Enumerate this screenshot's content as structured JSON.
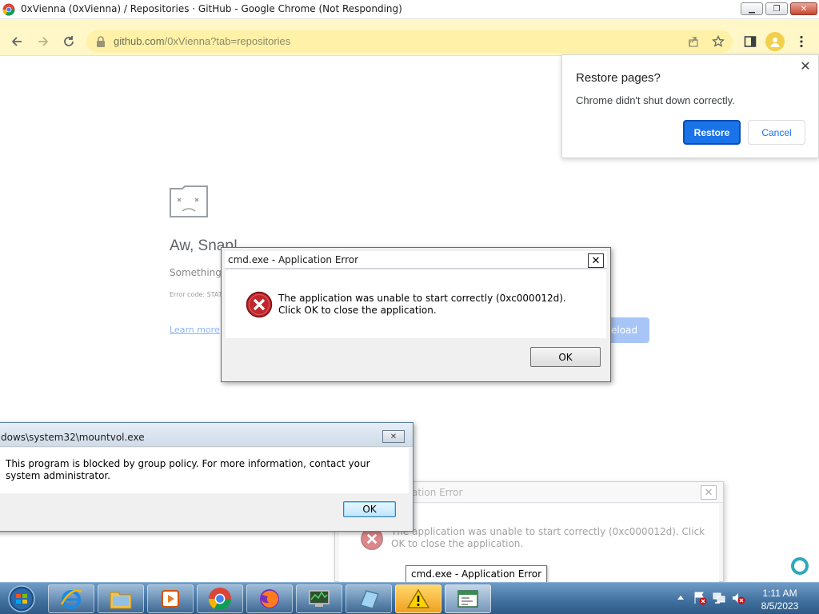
{
  "window": {
    "title": "0xVienna (0xVienna) / Repositories · GitHub - Google Chrome (Not Responding)",
    "url_host": "github.com",
    "url_path": "/0xVienna?tab=repositories"
  },
  "colors": {
    "toolbar_bg": "#fff7c7",
    "accent": "#1a73e8",
    "error_red": "#c0272d"
  },
  "crash_page": {
    "title": "Aw, Snap!",
    "subtitle": "Something",
    "error_code": "Error code: STAT",
    "learn_more": "Learn more",
    "reload_label": "eload"
  },
  "restore_bubble": {
    "title": "Restore pages?",
    "message": "Chrome didn't shut down correctly.",
    "restore_label": "Restore",
    "cancel_label": "Cancel",
    "close_symbol": "✕"
  },
  "cmd_error": {
    "title": "cmd.exe - Application Error",
    "message": "The application was unable to start correctly (0xc000012d). Click OK to close the application.",
    "ok_label": "OK",
    "close_symbol": "✕"
  },
  "mountvol_dialog": {
    "title": "dows\\system32\\mountvol.exe",
    "message": "This program is blocked by group policy. For more information, contact your system administrator.",
    "ok_label": "OK",
    "close_symbol": "✕"
  },
  "cmd_error_bg": {
    "title": "ation Error",
    "message": "The application was unable to start correctly (0xc000012d). Click OK to close the application.",
    "close_symbol": "✕"
  },
  "tooltip": "cmd.exe - Application Error",
  "taskbar": {
    "apps": [
      "ie-icon",
      "explorer-icon",
      "media-player-icon",
      "chrome-icon",
      "firefox-icon",
      "system-monitor-icon",
      "tablet-icon",
      "warning-icon",
      "application-icon"
    ],
    "time": "1:11 AM",
    "date": "8/5/2023"
  }
}
